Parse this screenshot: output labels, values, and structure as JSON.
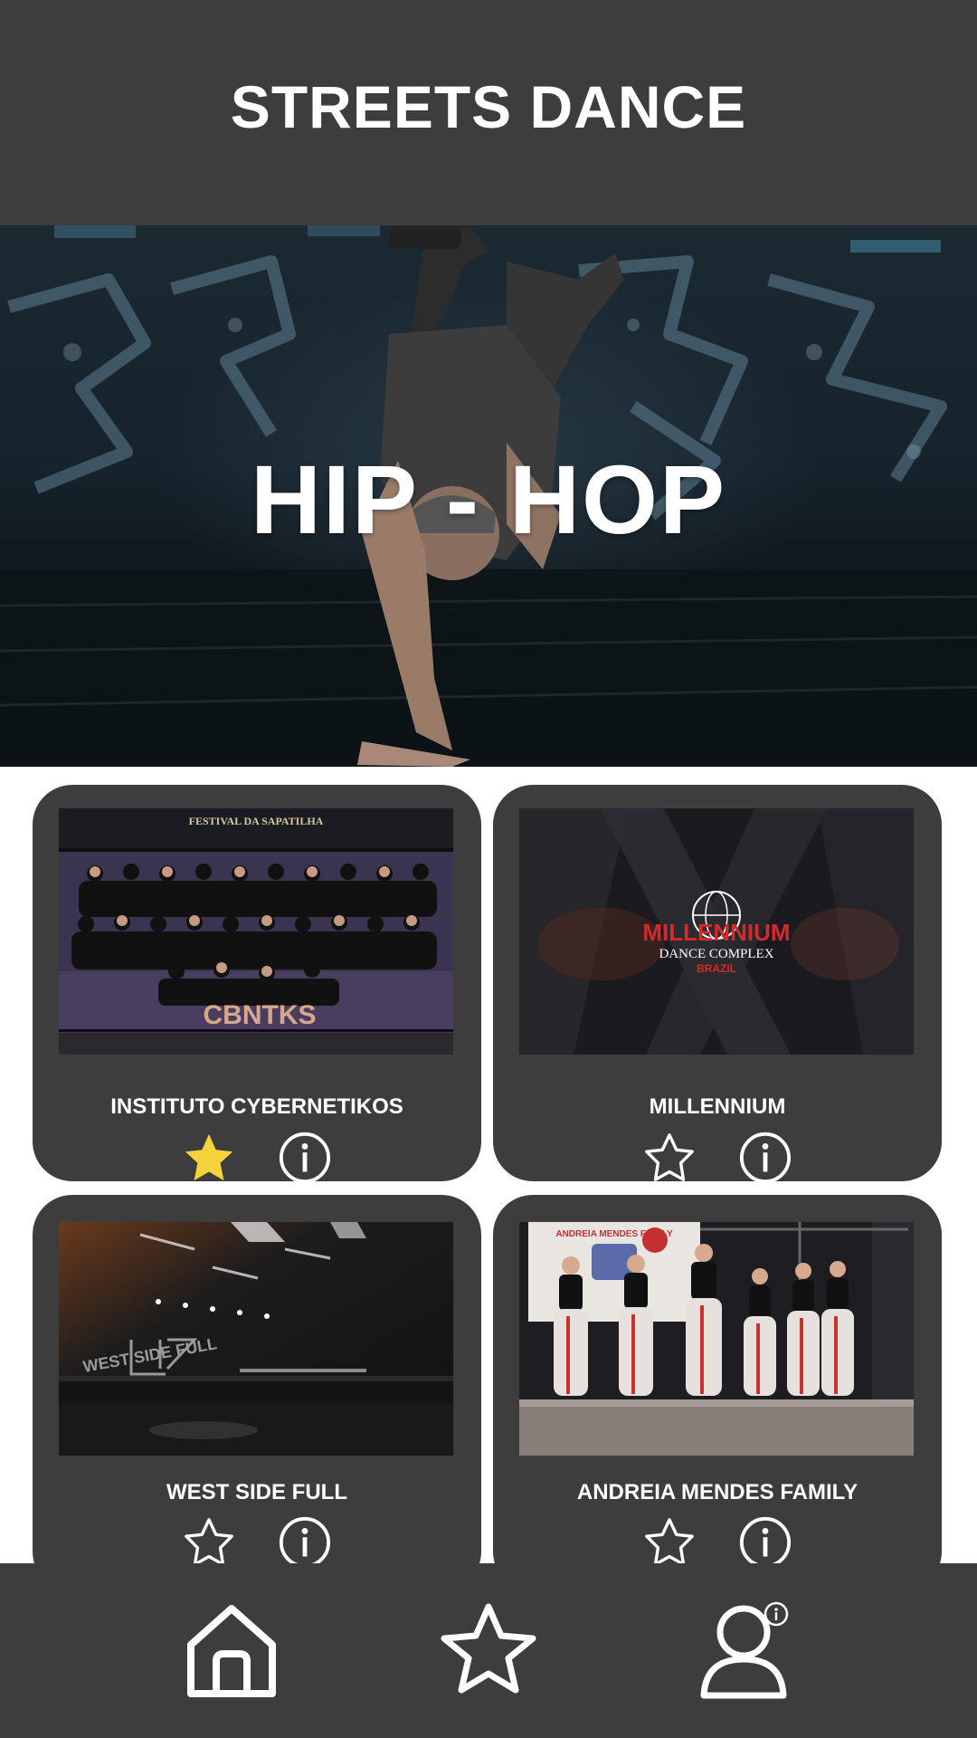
{
  "header": {
    "title": "STREETS DANCE"
  },
  "hero": {
    "title": "HIP - HOP"
  },
  "cards": [
    {
      "name": "INSTITUTO CYBERNETIKOS",
      "favorite": true,
      "thumb_text": "CBNTKS",
      "thumb_banner": "FESTIVAL DA SAPATILHA"
    },
    {
      "name": "MILLENNIUM",
      "favorite": false,
      "thumb_text": "MILLENNIUM",
      "thumb_sub": "DANCE COMPLEX",
      "thumb_sub2": "BRAZIL"
    },
    {
      "name": "WEST SIDE FULL",
      "favorite": false,
      "thumb_text": "WEST SIDE FULL"
    },
    {
      "name": "ANDREIA MENDES FAMILY",
      "favorite": false,
      "thumb_text": "ANDREIA MENDES FAMILY"
    }
  ],
  "nav": {
    "items": [
      {
        "icon": "home-icon"
      },
      {
        "icon": "star-icon"
      },
      {
        "icon": "profile-info-icon"
      }
    ]
  },
  "colors": {
    "bar": "#3d3d3d",
    "accent_star": "#f5d33b",
    "text": "#ffffff",
    "millennium_red": "#d42a2a"
  }
}
